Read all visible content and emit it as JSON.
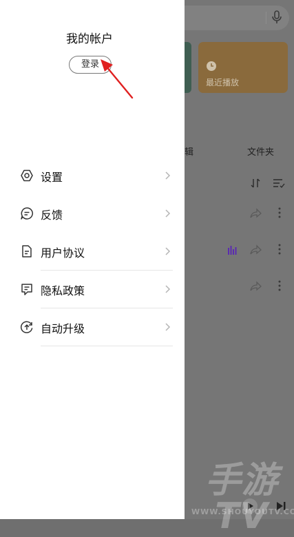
{
  "background_app": {
    "recent_card_label": "最近播放",
    "tab_album_partial": "辑",
    "tab_folder": "文件夹"
  },
  "drawer": {
    "title": "我的帐户",
    "login_label": "登录",
    "menu": [
      {
        "label": "设置",
        "icon": "gear-icon"
      },
      {
        "label": "反馈",
        "icon": "feedback-icon"
      },
      {
        "label": "用户协议",
        "icon": "document-icon"
      },
      {
        "label": "隐私政策",
        "icon": "privacy-icon"
      },
      {
        "label": "自动升级",
        "icon": "upgrade-icon"
      }
    ]
  },
  "watermark": {
    "text": "手游TV",
    "url": "WWW.SHOUYOUTV.COM"
  },
  "colors": {
    "annotation_arrow": "#e02020",
    "overlay": "#767676",
    "recent_card": "#8a6a3c",
    "now_playing_bars": "#5b2bb0"
  }
}
